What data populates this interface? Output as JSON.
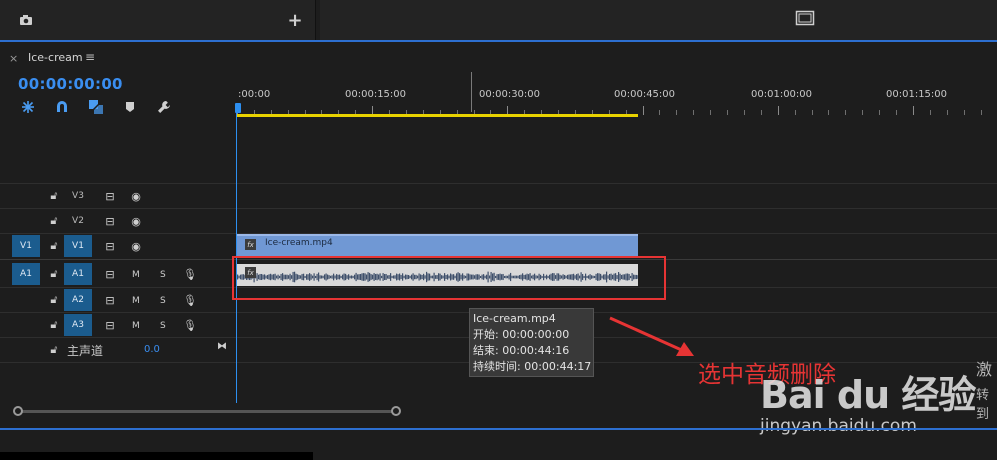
{
  "top_bar": {
    "left_icons": [
      "camera-icon",
      "plus-icon"
    ],
    "right_icons": [
      "monitor-frame-icon"
    ]
  },
  "sequence_tab": {
    "close": "×",
    "title": "Ice-cream",
    "menu": "≡"
  },
  "timecode": "00:00:00:00",
  "toolbar": {
    "icons": [
      "snap-icon",
      "magnet-icon",
      "linked-selection-icon",
      "marker-icon",
      "wrench-icon"
    ]
  },
  "ruler": {
    "labels": [
      ":00:00",
      "00:00:15:00",
      "00:00:30:00",
      "00:00:45:00",
      "00:01:00:00",
      "00:01:15:00"
    ]
  },
  "tracks": {
    "video": [
      {
        "label": "V3",
        "source": ""
      },
      {
        "label": "V2",
        "source": ""
      },
      {
        "label": "V1",
        "source": "V1"
      }
    ],
    "audio": [
      {
        "label": "A1",
        "source": "A1",
        "m": "M",
        "s": "S"
      },
      {
        "label": "A2",
        "source": "",
        "m": "M",
        "s": "S"
      },
      {
        "label": "A3",
        "source": "",
        "m": "M",
        "s": "S"
      }
    ],
    "master": {
      "label": "主声道",
      "value": "0.0"
    }
  },
  "clips": {
    "video_name": "Ice-cream.mp4",
    "fx": "fx"
  },
  "tooltip": {
    "name": "Ice-cream.mp4",
    "start": "开始: 00:00:00:00",
    "end": "结束: 00:00:44:16",
    "duration": "持续时间: 00:00:44:17"
  },
  "annotation": {
    "text": "选中音频删除",
    "color": "#e63434"
  },
  "edge_text": {
    "line1": "激",
    "line2": "转到"
  },
  "watermark": {
    "main": "Bai du 经验",
    "sub": "jingyan.baidu.com"
  },
  "colors": {
    "accent_blue": "#2d8ff0",
    "work_area": "#e8d200",
    "video_clip": "#7098d4",
    "target_on": "#1b5c8e"
  }
}
